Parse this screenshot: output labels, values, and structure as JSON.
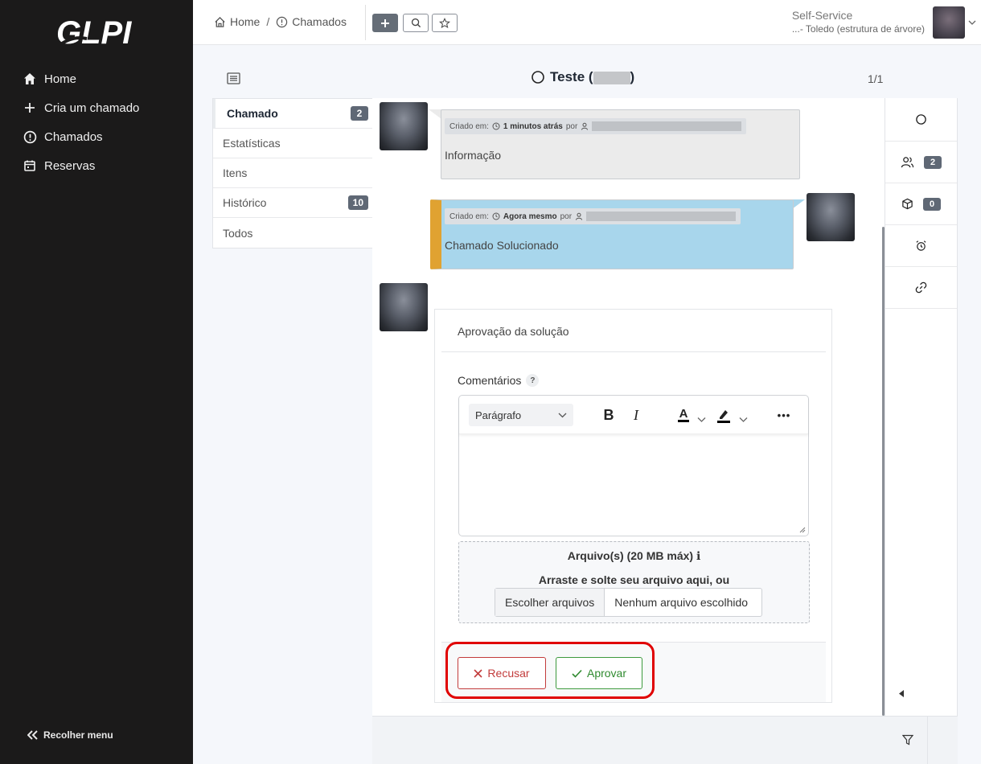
{
  "sidebar": {
    "logo_text": "GLPI",
    "items": [
      {
        "label": "Home",
        "icon": "home-icon"
      },
      {
        "label": "Cria um chamado",
        "icon": "plus-icon"
      },
      {
        "label": "Chamados",
        "icon": "alert-circle-icon"
      },
      {
        "label": "Reservas",
        "icon": "calendar-icon"
      }
    ],
    "collapse_label": "Recolher menu"
  },
  "header": {
    "breadcrumb": [
      {
        "label": "Home",
        "icon": "home-icon"
      },
      {
        "label": "Chamados",
        "icon": "alert-circle-icon"
      }
    ],
    "separator": "/",
    "profile_name": "Self-Service",
    "entity": "...- Toledo (estrutura de árvore)"
  },
  "ticket": {
    "title": "Teste (",
    "title_close": ")",
    "pager": "1/1"
  },
  "tabs": [
    {
      "label": "Chamado",
      "count": "2",
      "active": true
    },
    {
      "label": "Estatísticas",
      "count": null
    },
    {
      "label": "Itens",
      "count": null
    },
    {
      "label": "Histórico",
      "count": "10"
    },
    {
      "label": "Todos",
      "count": null
    }
  ],
  "right_bar": {
    "actors_count": "2",
    "items_count": "0"
  },
  "timeline": {
    "entry1": {
      "created_label": "Criado em:",
      "time": "1 minutos atrás",
      "by": "por",
      "content": "Informação",
      "bg": "#ebebeb"
    },
    "entry2": {
      "created_label": "Criado em:",
      "time": "Agora mesmo",
      "by": "por",
      "content": "Chamado Solucionado",
      "bg": "#a8d6ec",
      "accent": "#e0a231"
    }
  },
  "approval": {
    "title": "Aprovação da solução",
    "comments_label": "Comentários",
    "help": "?",
    "editor": {
      "paragraph": "Parágrafo",
      "bold": "B",
      "italic": "I",
      "font_color": "A",
      "more": "•••"
    },
    "dropzone_title": "Arquivo(s) (20 MB máx)",
    "dropzone_info": "ℹ",
    "dropzone_sub": "Arraste e solte seu arquivo aqui, ou",
    "choose_files": "Escolher arquivos",
    "no_file": "Nenhum arquivo escolhido",
    "refuse_label": "Recusar",
    "approve_label": "Aprovar"
  },
  "colors": {
    "sidebar": "#1b1a1a",
    "refuse": "#c23b3b",
    "approve": "#2f8a2f",
    "highlight": "#e00000"
  }
}
